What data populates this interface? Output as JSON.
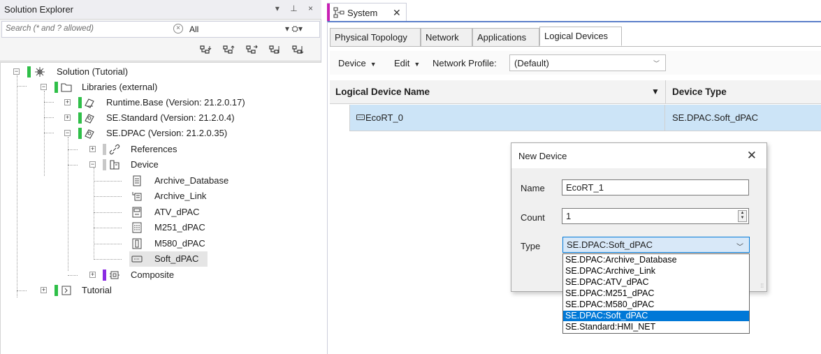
{
  "solution_explorer": {
    "title": "Solution Explorer",
    "window_controls": "▾ ⊥ ×",
    "search_placeholder": "Search (* and ? allowed)",
    "scope": "All",
    "tree": {
      "solution": "Solution  (Tutorial)",
      "libraries": "Libraries (external)",
      "runtime_base": "Runtime.Base  (Version: 21.2.0.17)",
      "se_standard": "SE.Standard  (Version: 21.2.0.4)",
      "se_dpac": "SE.DPAC  (Version: 21.2.0.35)",
      "references": "References",
      "device": "Device",
      "archive_database": "Archive_Database",
      "archive_link": "Archive_Link",
      "atv_dpac": "ATV_dPAC",
      "m251_dpac": "M251_dPAC",
      "m580_dpac": "M580_dPAC",
      "soft_dpac": "Soft_dPAC",
      "composite": "Composite",
      "tutorial": "Tutorial"
    }
  },
  "document": {
    "tab_title": "System",
    "tabs": [
      "Physical Topology",
      "Network",
      "Applications",
      "Logical Devices"
    ],
    "active_tab": "Logical Devices",
    "toolbar": {
      "device": "Device",
      "edit": "Edit",
      "network_profile_label": "Network Profile:",
      "network_profile_value": "(Default)"
    },
    "grid": {
      "col_name": "Logical Device Name",
      "col_type": "Device Type",
      "rows": [
        {
          "name": "EcoRT_0",
          "type": "SE.DPAC.Soft_dPAC"
        }
      ]
    }
  },
  "dialog": {
    "title": "New Device",
    "name_label": "Name",
    "name_value": "EcoRT_1",
    "count_label": "Count",
    "count_value": "1",
    "type_label": "Type",
    "type_value": "SE.DPAC:Soft_dPAC",
    "type_options": [
      "SE.DPAC:Archive_Database",
      "SE.DPAC:Archive_Link",
      "SE.DPAC:ATV_dPAC",
      "SE.DPAC:M251_dPAC",
      "SE.DPAC:M580_dPAC",
      "SE.DPAC:Soft_dPAC",
      "SE.Standard:HMI_NET"
    ],
    "selected_option_index": 5
  },
  "colors": {
    "accent": "#0078d7",
    "selected_row": "#cce4f7",
    "status_green": "#2fbf48",
    "status_purple": "#8a2be2",
    "doc_tab_marker": "#c81fb4"
  }
}
